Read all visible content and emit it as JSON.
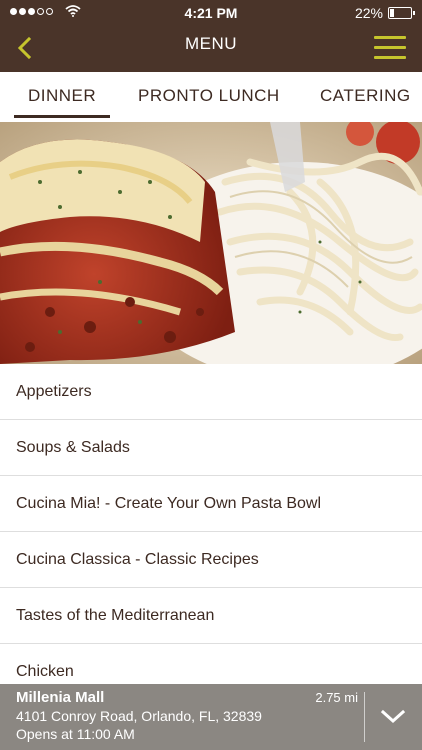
{
  "status": {
    "time": "4:21 PM",
    "battery": "22%",
    "battery_level": 0.22,
    "signal_bars_filled": 3,
    "signal_bars_total": 5
  },
  "nav": {
    "title": "MENU",
    "back_icon": "chevron-left-icon",
    "menu_icon": "hamburger-menu-icon"
  },
  "tabs": [
    {
      "label": "DINNER",
      "active": true
    },
    {
      "label": "PRONTO LUNCH",
      "active": false
    },
    {
      "label": "CATERING",
      "active": false
    }
  ],
  "hero": {
    "description_icon": "food-photo"
  },
  "categories": [
    "Appetizers",
    "Soups & Salads",
    "Cucina Mia! - Create Your Own Pasta Bowl",
    "Cucina Classica - Classic Recipes",
    "Tastes of the Mediterranean",
    "Chicken"
  ],
  "location": {
    "name": "Millenia Mall",
    "address": "4101 Conroy Road, Orlando, FL, 32839",
    "hours": "Opens at 11:00 AM",
    "distance": "2.75 mi",
    "expand_icon": "chevron-down-icon"
  },
  "colors": {
    "header_bg": "#4a3429",
    "accent": "#c6c52d",
    "text_dark": "#3d2a22",
    "footer_bg": "#8b8782"
  }
}
